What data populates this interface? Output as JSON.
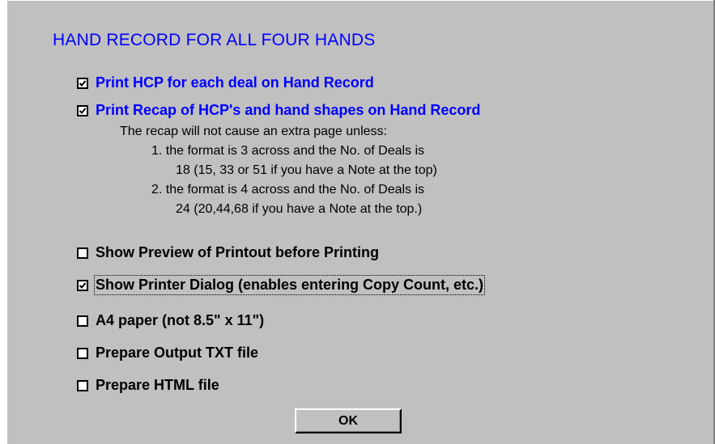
{
  "dialog": {
    "title": "HAND RECORD FOR ALL FOUR HANDS",
    "options": [
      {
        "label": "Print HCP for each deal on Hand Record",
        "checked": true,
        "color": "#0000ff"
      },
      {
        "label": "Print Recap of HCP's and hand shapes on Hand Record",
        "checked": true,
        "color": "#0000ff"
      },
      {
        "label": "Show Preview of Printout before Printing",
        "checked": false,
        "color": "#000000"
      },
      {
        "label": "Show Printer Dialog (enables entering Copy Count, etc.)",
        "checked": true,
        "color": "#000000",
        "focused": true
      },
      {
        "label": "A4 paper (not 8.5\" x 11\")",
        "checked": false,
        "color": "#000000"
      },
      {
        "label": "Prepare Output TXT file",
        "checked": false,
        "color": "#000000"
      },
      {
        "label": "Prepare HTML file",
        "checked": false,
        "color": "#000000"
      }
    ],
    "recap_note": [
      "The recap will not cause an extra page unless:",
      "1. the format is 3 across and the No. of Deals is",
      "18 (15, 33 or 51 if you have a Note at the top)",
      "2. the format is 4 across and the No. of Deals is",
      "24 (20,44,68 if you have a Note at the top.)"
    ],
    "ok_label": "OK"
  }
}
